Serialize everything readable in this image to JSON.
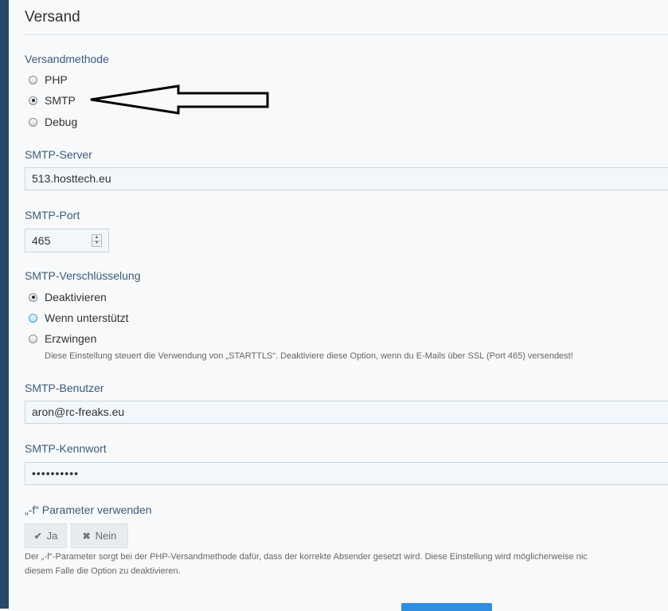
{
  "section": {
    "title": "Versand"
  },
  "method": {
    "label": "Versandmethode",
    "options": [
      {
        "label": "PHP",
        "checked": false
      },
      {
        "label": "SMTP",
        "checked": true
      },
      {
        "label": "Debug",
        "checked": false
      }
    ]
  },
  "smtp_server": {
    "label": "SMTP-Server",
    "value": "513.hosttech.eu"
  },
  "smtp_port": {
    "label": "SMTP-Port",
    "value": "465"
  },
  "encryption": {
    "label": "SMTP-Verschlüsselung",
    "options": [
      {
        "label": "Deaktivieren",
        "checked": true
      },
      {
        "label": "Wenn unterstützt",
        "checked": false
      },
      {
        "label": "Erzwingen",
        "checked": false
      }
    ],
    "help": "Diese Einstellung steuert die Verwendung von „STARTTLS“. Deaktiviere diese Option, wenn du E-Mails über SSL (Port 465) versendest!"
  },
  "smtp_user": {
    "label": "SMTP-Benutzer",
    "value": "aron@rc-freaks.eu"
  },
  "smtp_password": {
    "label": "SMTP-Kennwort",
    "value": "••••••••••"
  },
  "f_param": {
    "label": "„-f“ Parameter verwenden",
    "yes_label": "Ja",
    "no_label": "Nein",
    "help_line1": "Der „-f“-Parameter sorgt bei der PHP-Versandmethode dafür, dass der korrekte Absender gesetzt wird. Diese Einstellung wird möglicherweise nic",
    "help_line2": "diesem Falle die Option zu deaktivieren."
  },
  "colors": {
    "sidebar": "#284866",
    "label": "#3d5a78",
    "primary": "#2f8ee0"
  }
}
